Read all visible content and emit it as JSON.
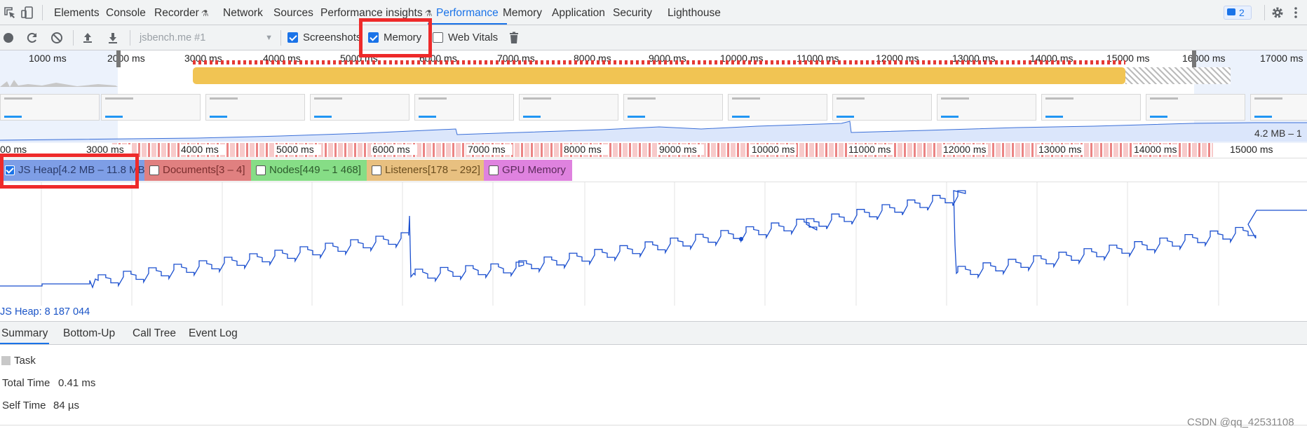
{
  "main_tabs": [
    {
      "label": "Elements",
      "active": false
    },
    {
      "label": "Console",
      "active": false
    },
    {
      "label": "Recorder",
      "active": false,
      "experimental": true
    },
    {
      "label": "Network",
      "active": false
    },
    {
      "label": "Sources",
      "active": false
    },
    {
      "label": "Performance insights",
      "active": false,
      "experimental": true
    },
    {
      "label": "Performance",
      "active": true
    },
    {
      "label": "Memory",
      "active": false
    },
    {
      "label": "Application",
      "active": false
    },
    {
      "label": "Security",
      "active": false
    },
    {
      "label": "Lighthouse",
      "active": false
    }
  ],
  "issues_count": "2",
  "toolbar": {
    "profile_select": "jsbench.me #1",
    "screenshots_label": "Screenshots",
    "screenshots_checked": true,
    "memory_label": "Memory",
    "memory_checked": true,
    "web_vitals_label": "Web Vitals",
    "web_vitals_checked": false
  },
  "overview": {
    "ticks": [
      "1000 ms",
      "2000 ms",
      "3000 ms",
      "4000 ms",
      "5000 ms",
      "6000 ms",
      "7000 ms",
      "8000 ms",
      "9000 ms",
      "10000 ms",
      "11000 ms",
      "12000 ms",
      "13000 ms",
      "14000 ms",
      "15000 ms",
      "16000 ms",
      "17000 ms"
    ],
    "heap_range_label": "4.2 MB – 1"
  },
  "ruler_ticks": [
    "3000 ms",
    "4000 ms",
    "5000 ms",
    "6000 ms",
    "7000 ms",
    "8000 ms",
    "9000 ms",
    "10000 ms",
    "11000 ms",
    "12000 ms",
    "13000 ms",
    "14000 ms",
    "15000 ms"
  ],
  "ruler_left_partial": "00 ms",
  "counters": [
    {
      "label": "JS Heap[4.2 MB – 11.8 MB]",
      "checked": true,
      "color": "#7e9ee6",
      "text_color": "#2b3c6b"
    },
    {
      "label": "Documents[3 – 4]",
      "checked": false,
      "color": "#e08080",
      "text_color": "#7a2e2e"
    },
    {
      "label": "Nodes[449 – 1 468]",
      "checked": false,
      "color": "#86dd86",
      "text_color": "#2c5b2c"
    },
    {
      "label": "Listeners[178 – 292]",
      "checked": false,
      "color": "#e8c080",
      "text_color": "#6a4d1e"
    },
    {
      "label": "GPU Memory",
      "checked": false,
      "color": "#df82df",
      "text_color": "#5d2a5d"
    }
  ],
  "heap_value_label": "JS Heap: 8 187 044",
  "detail_tabs": [
    {
      "label": "Summary",
      "active": true
    },
    {
      "label": "Bottom-Up",
      "active": false
    },
    {
      "label": "Call Tree",
      "active": false
    },
    {
      "label": "Event Log",
      "active": false
    }
  ],
  "summary": {
    "event_name": "Task",
    "total_time_label": "Total Time",
    "total_time_value": "0.41 ms",
    "self_time_label": "Self Time",
    "self_time_value": "84 µs"
  },
  "watermark": "CSDN @qq_42531108",
  "colors": {
    "accent": "#1a73e8",
    "heap_line": "#1a4fcf",
    "highlight": "#ee2a2a",
    "cpu_band": "#f1c453"
  }
}
